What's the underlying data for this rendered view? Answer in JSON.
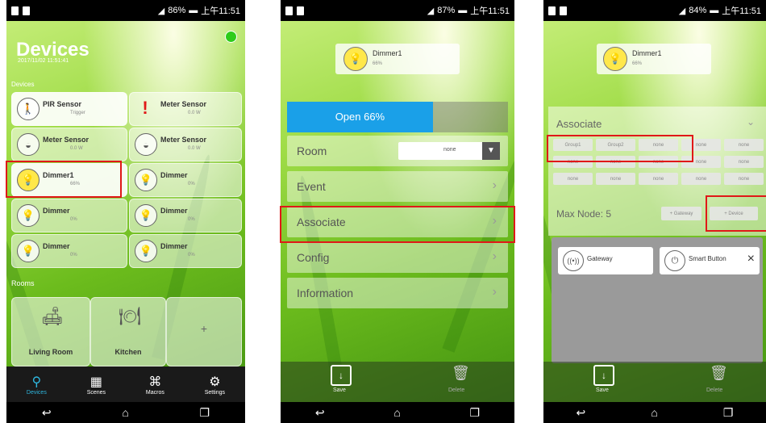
{
  "phone1": {
    "status": {
      "battery": "86%",
      "time": "上午11:51"
    },
    "title": "Devices",
    "subtitle": "2017/11/02 11:51:41",
    "section_devices": "Devices",
    "tiles": [
      {
        "name": "PIR Sensor",
        "sub": "Trigger"
      },
      {
        "name": "Meter Sensor",
        "sub": "0.0 W"
      },
      {
        "name": "Meter Sensor",
        "sub": "0.0 W"
      },
      {
        "name": "Meter Sensor",
        "sub": "0.0 W"
      },
      {
        "name": "Dimmer1",
        "sub": "66%"
      },
      {
        "name": "Dimmer",
        "sub": "0%"
      },
      {
        "name": "Dimmer",
        "sub": "0%"
      },
      {
        "name": "Dimmer",
        "sub": "0%"
      },
      {
        "name": "Dimmer",
        "sub": "0%"
      },
      {
        "name": "Dimmer",
        "sub": "0%"
      }
    ],
    "section_rooms": "Rooms",
    "rooms": [
      "Living Room",
      "Kitchen",
      "+"
    ],
    "tabs": [
      "Devices",
      "Scenes",
      "Macros",
      "Settings"
    ]
  },
  "phone2": {
    "status": {
      "battery": "87%",
      "time": "上午11:51"
    },
    "device": {
      "name": "Dimmer1",
      "sub": "66%"
    },
    "open_label": "Open 66%",
    "menu": [
      "Room",
      "Event",
      "Associate",
      "Config",
      "Information"
    ],
    "room_value": "none",
    "save": "Save",
    "delete": "Delete"
  },
  "phone3": {
    "status": {
      "battery": "84%",
      "time": "上午11:51"
    },
    "device": {
      "name": "Dimmer1",
      "sub": "66%"
    },
    "associate": "Associate",
    "grid": [
      "Group1",
      "Group2",
      "none",
      "none",
      "none",
      "none",
      "none",
      "none",
      "none",
      "none",
      "none",
      "none",
      "none",
      "none",
      "none"
    ],
    "max_node": "Max Node: 5",
    "add_gateway": "+ Gateway",
    "add_device": "+ Device",
    "nodes": [
      "Gateway",
      "Smart Button"
    ],
    "close": "×",
    "save": "Save",
    "delete": "Delete"
  }
}
